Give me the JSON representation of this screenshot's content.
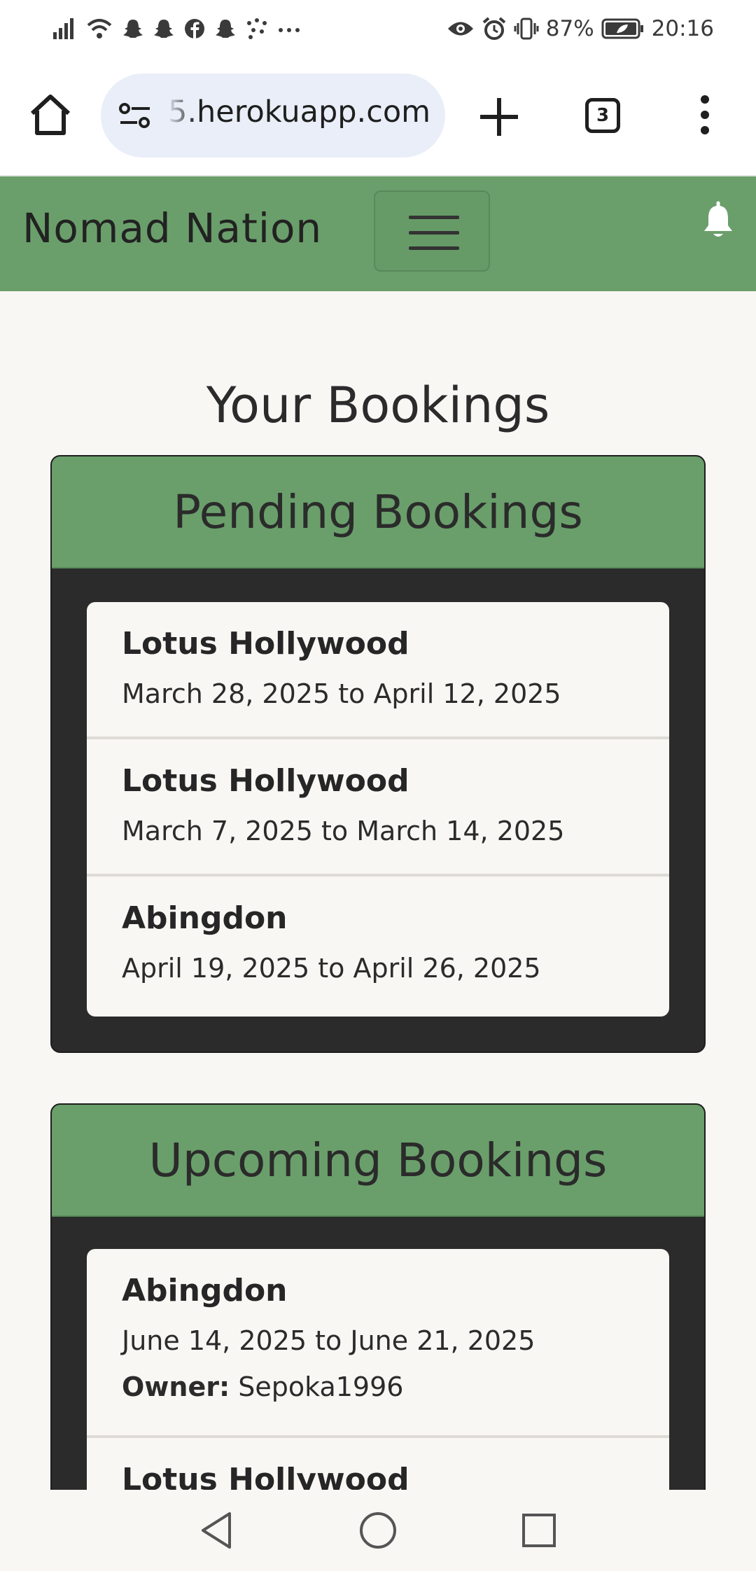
{
  "status_bar": {
    "battery": "87%",
    "time": "20:16",
    "left_icons": [
      "signal-icon",
      "wifi-icon",
      "snapchat-icon",
      "snapchat-icon",
      "facebook-icon",
      "snapchat-icon",
      "dots-app-icon",
      "more-icon"
    ],
    "right_icons": [
      "eye-icon",
      "alarm-icon",
      "vibrate-icon",
      "battery-icon"
    ]
  },
  "browser": {
    "url": "5.herokuapp.com",
    "tab_count": "3"
  },
  "navbar": {
    "brand": "Nomad Nation",
    "color": "#6a9f6b"
  },
  "page": {
    "title": "Your Bookings"
  },
  "pending": {
    "header": "Pending Bookings",
    "items": [
      {
        "name": "Lotus Hollywood",
        "dates": "March 28, 2025 to April 12, 2025"
      },
      {
        "name": "Lotus Hollywood",
        "dates": "March 7, 2025 to March 14, 2025"
      },
      {
        "name": "Abingdon",
        "dates": "April 19, 2025 to April 26, 2025"
      }
    ]
  },
  "upcoming": {
    "header": "Upcoming Bookings",
    "items": [
      {
        "name": "Abingdon",
        "dates": "June 14, 2025 to June 21, 2025",
        "owner_label": "Owner:",
        "owner": "Sepoka1996"
      },
      {
        "name": "Lotus Hollywood"
      }
    ]
  }
}
